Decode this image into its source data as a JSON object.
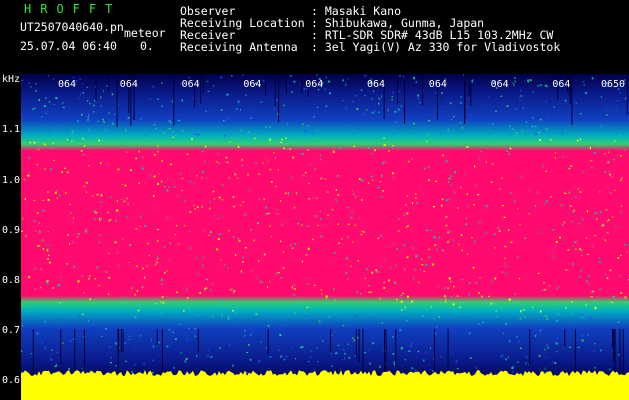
{
  "header": {
    "logo": "HROFFT",
    "filename": "UT2507040640.pn",
    "mode": "meteor",
    "datetime": "25.07.04 06:40",
    "counter": "0.",
    "fields": [
      {
        "label": "Observer",
        "value": ": Masaki Kano"
      },
      {
        "label": "Receiving Location",
        "value": ": Shibukawa, Gunma, Japan"
      },
      {
        "label": "Receiver",
        "value": ": RTL-SDR SDR# 43dB L15 103.2MHz CW"
      },
      {
        "label": "Receiving Antenna",
        "value": ": 3el Yagi(V) Az 330 for Vladivostok"
      }
    ]
  },
  "axis": {
    "unit": "kHz",
    "y_ticks": [
      "1.1",
      "1.0",
      "0.9",
      "0.8",
      "0.7",
      "0.6"
    ],
    "time_ticks": [
      "064",
      "064",
      "064",
      "064",
      "064",
      "064",
      "064",
      "064",
      "064",
      "0650"
    ]
  },
  "colors": {
    "signal": "#ff0a6e",
    "noise_low": "#00004a",
    "noise_mid": "#1030c0",
    "noise_high": "#00c8c8",
    "baseline": "#ffff00",
    "logo": "#2ee82e"
  }
}
